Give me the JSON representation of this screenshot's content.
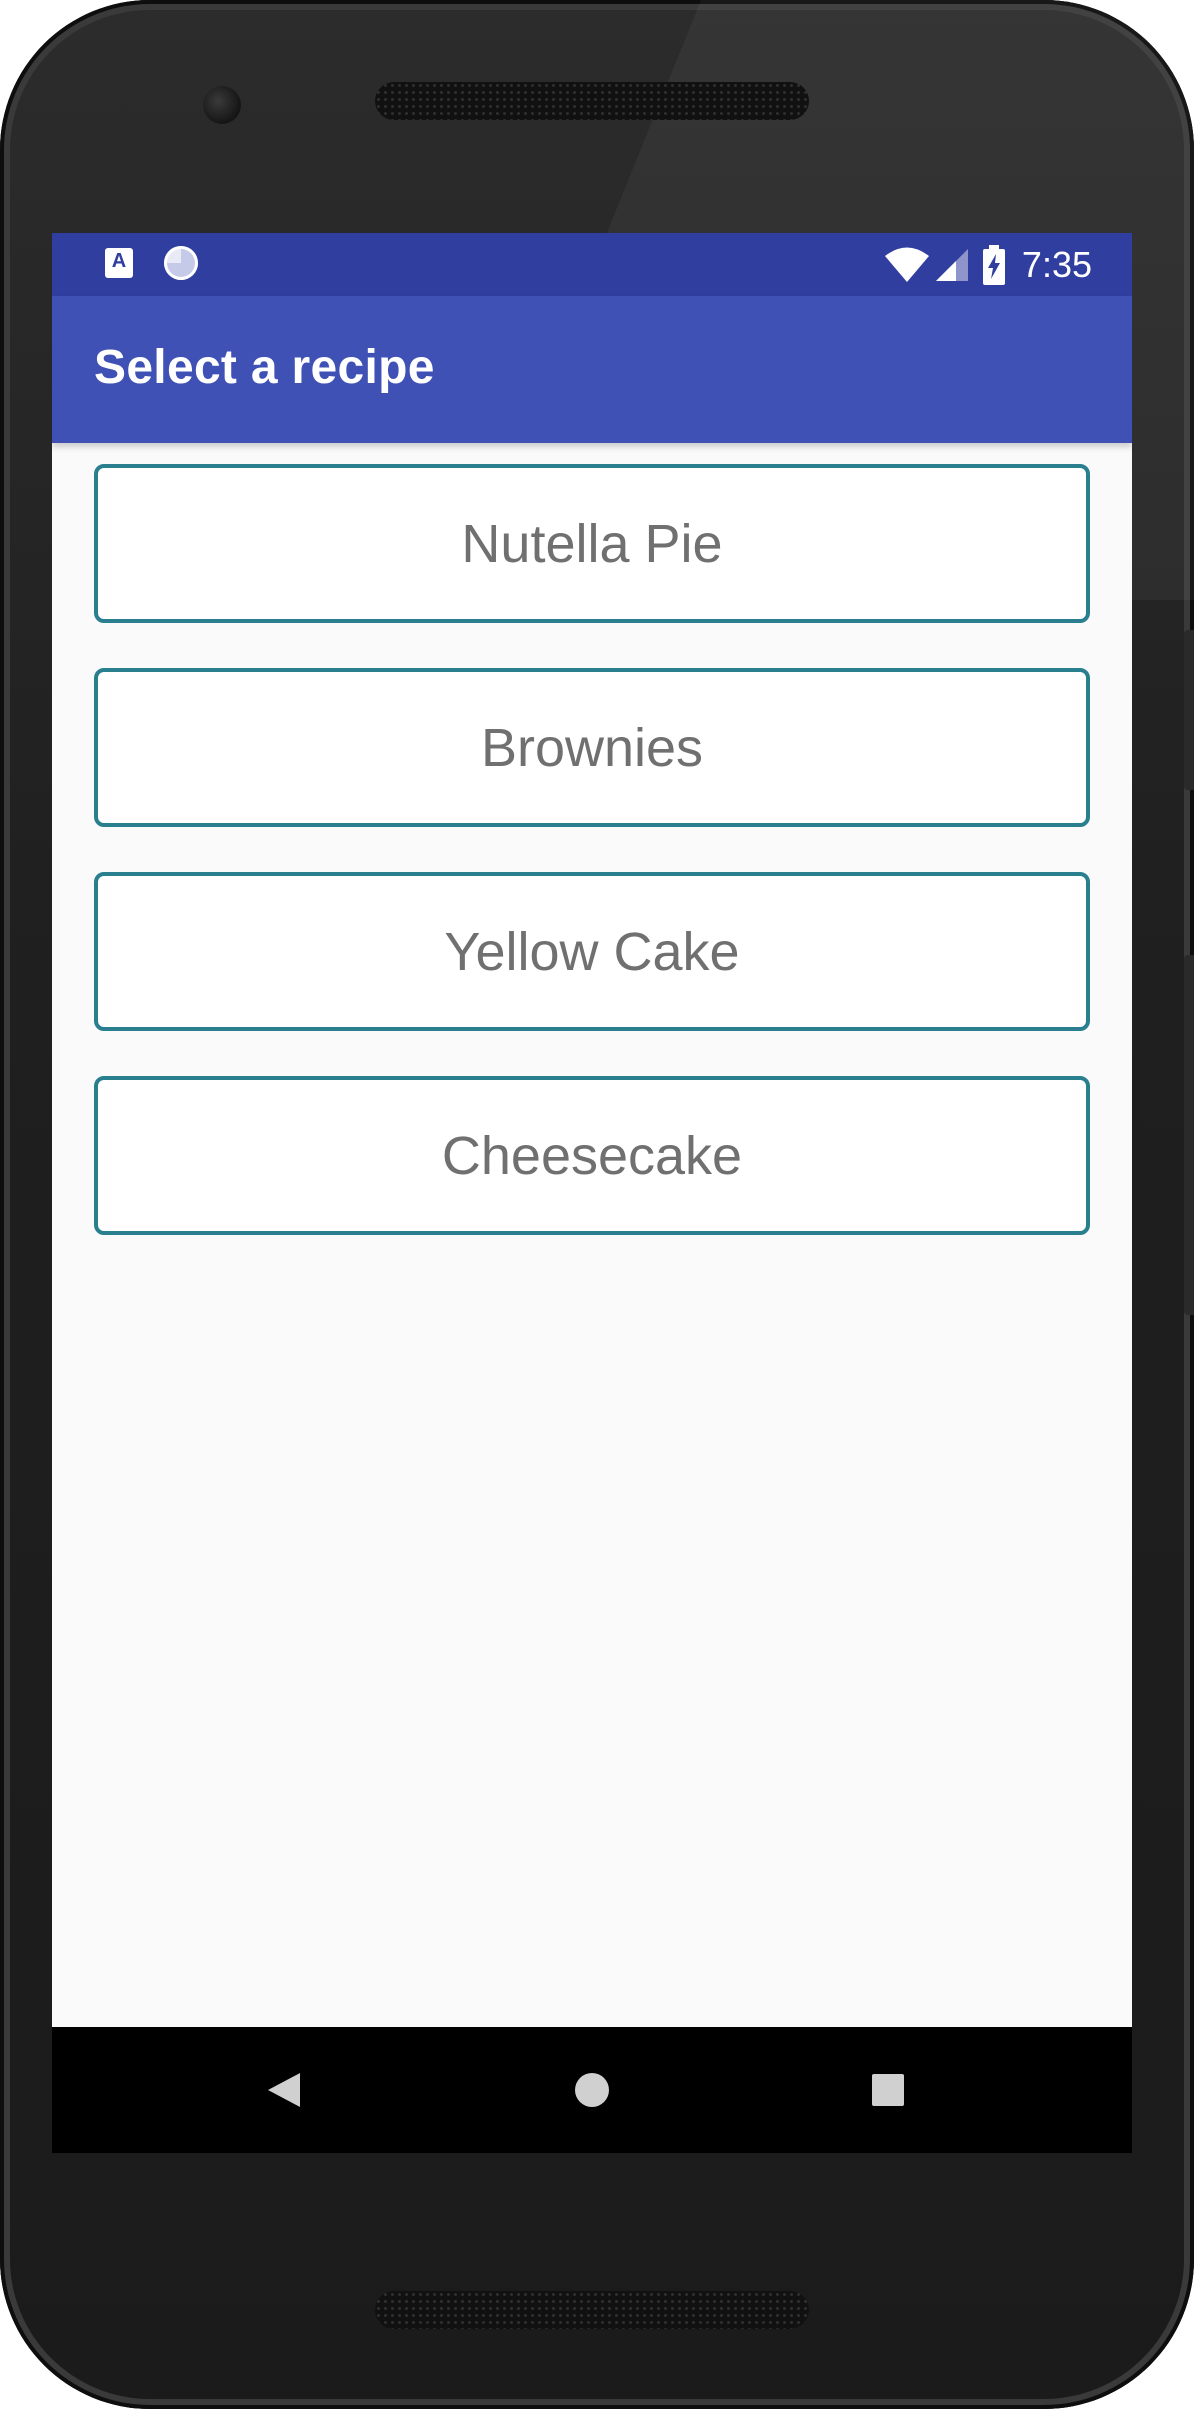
{
  "status_bar": {
    "time": "7:35",
    "notification_icon_letter": "A",
    "icons": [
      "text-notification-icon",
      "sync-progress-icon",
      "wifi-icon",
      "cell-signal-icon",
      "battery-charging-icon"
    ]
  },
  "app_bar": {
    "title": "Select a recipe",
    "color": "#3f51b5",
    "status_color": "#303f9f"
  },
  "recipes": [
    {
      "label": "Nutella Pie"
    },
    {
      "label": "Brownies"
    },
    {
      "label": "Yellow Cake"
    },
    {
      "label": "Cheesecake"
    }
  ],
  "card_border_color": "#2a7f8f",
  "nav_bar": {
    "buttons": [
      "back-icon",
      "home-icon",
      "recents-icon"
    ]
  }
}
